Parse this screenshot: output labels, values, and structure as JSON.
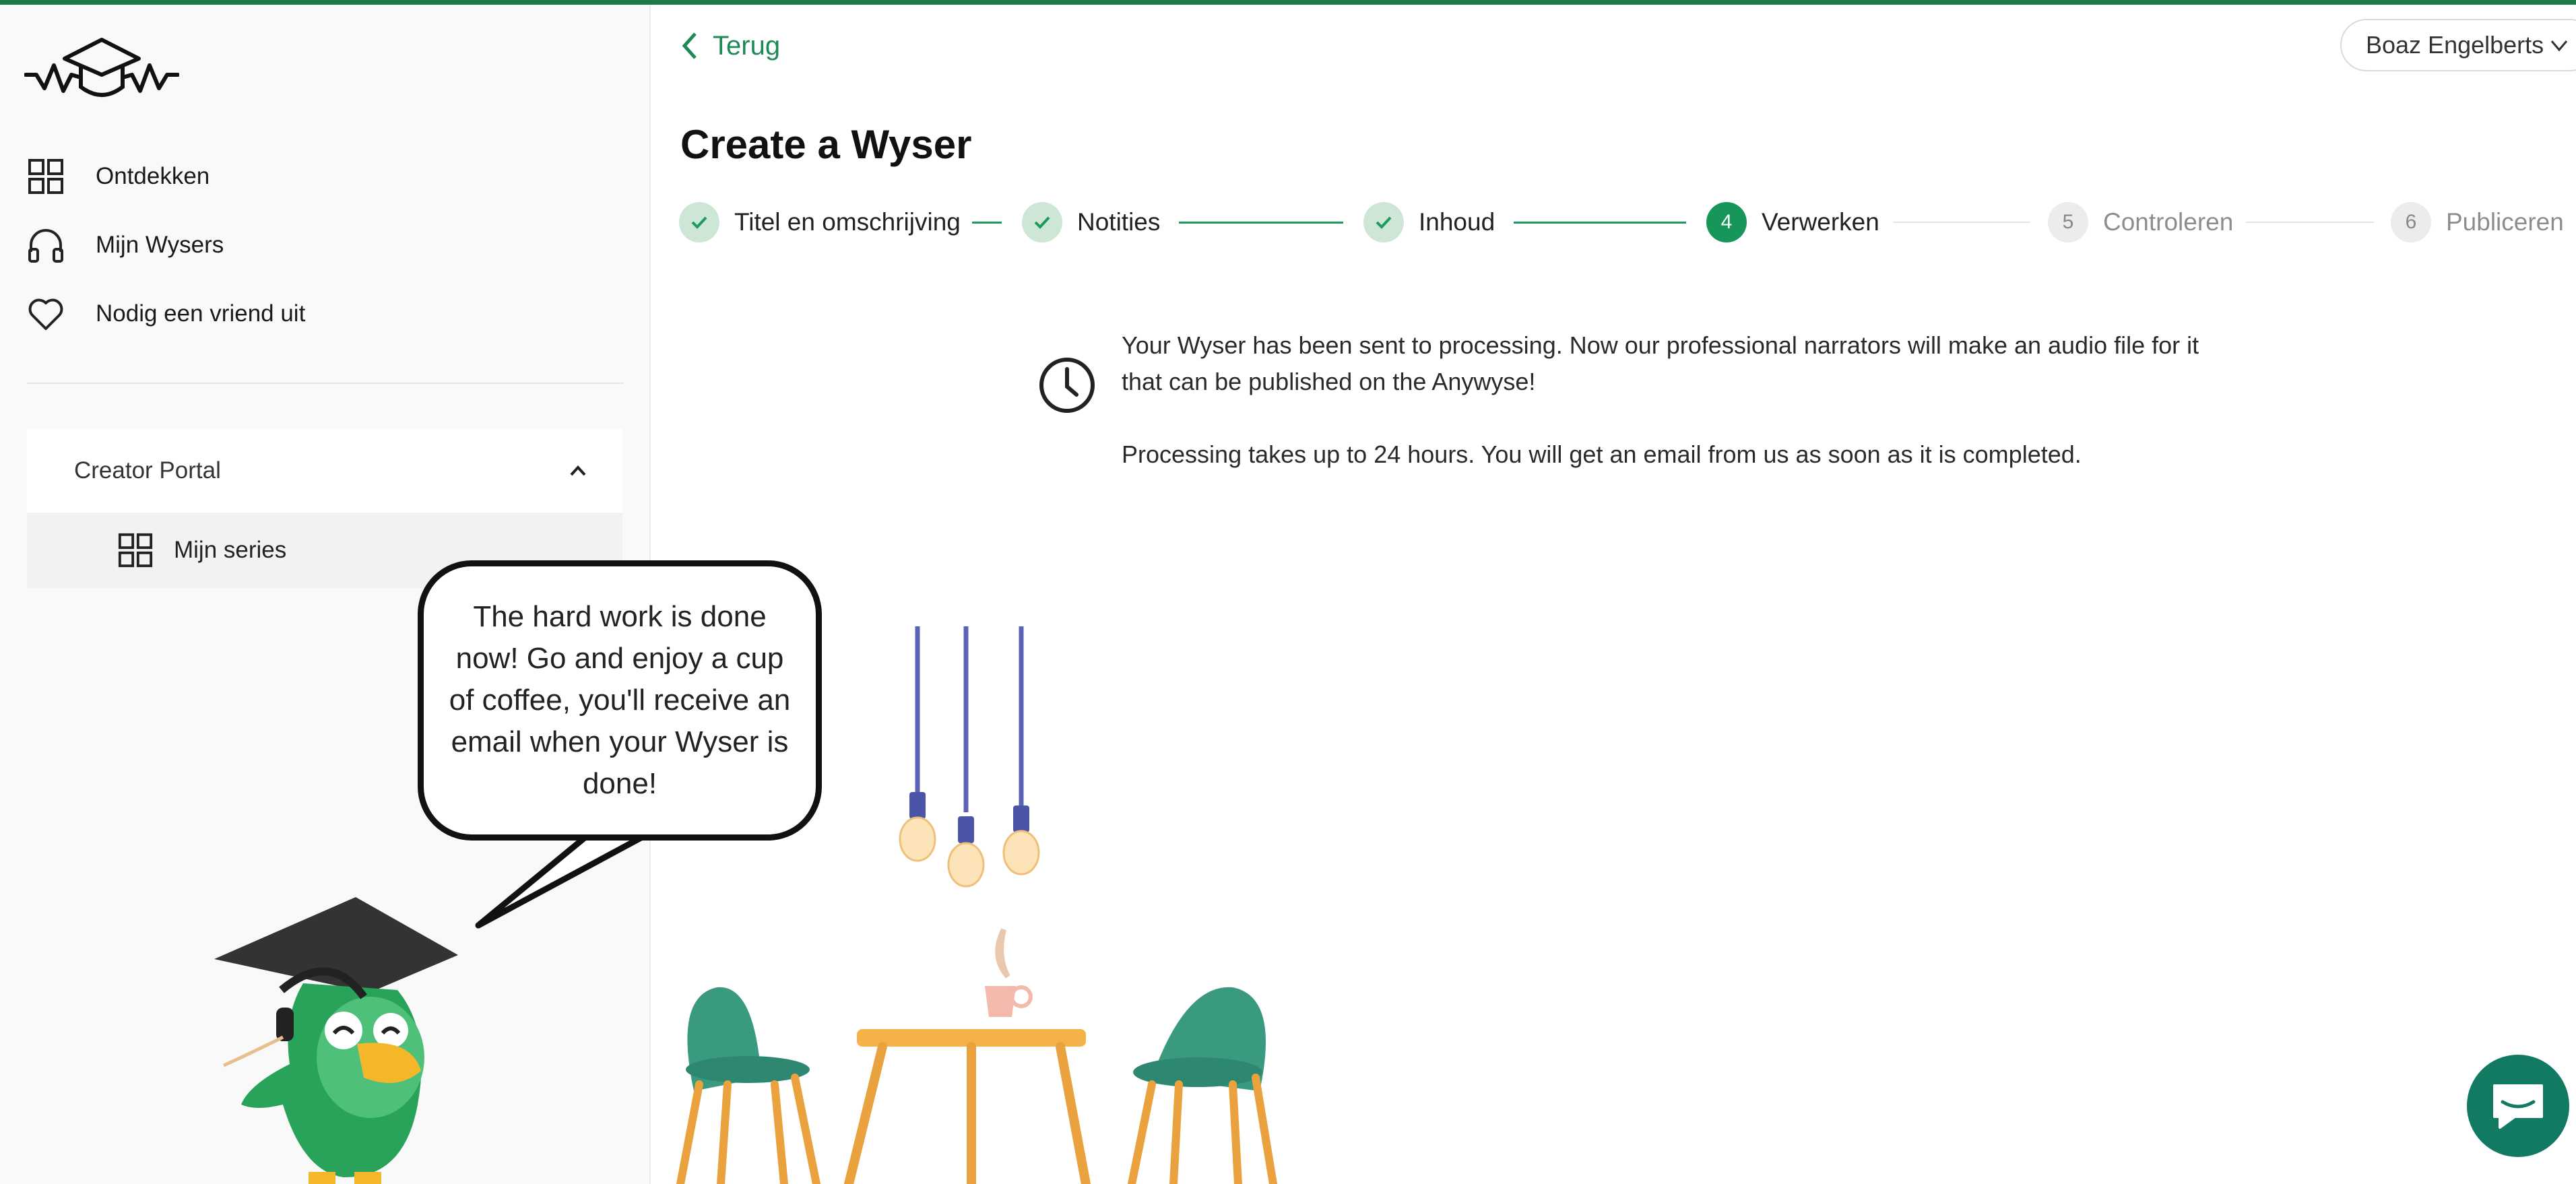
{
  "nav": {
    "items": [
      {
        "label": "Ontdekken",
        "icon": "grid-icon"
      },
      {
        "label": "Mijn Wysers",
        "icon": "headphones-icon"
      },
      {
        "label": "Nodig een vriend uit",
        "icon": "heart-icon"
      }
    ],
    "creator_portal": {
      "label": "Creator Portal",
      "expanded": true,
      "items": [
        {
          "label": "Mijn series",
          "icon": "grid-icon"
        }
      ]
    }
  },
  "bubble": {
    "text": "The hard work is done now! Go and enjoy a cup of coffee, you'll receive an email when your Wyser is done!"
  },
  "header": {
    "back_label": "Terug",
    "user_name": "Boaz Engelberts"
  },
  "page": {
    "title": "Create a Wyser"
  },
  "stepper": {
    "current_step": 4,
    "steps": [
      {
        "number": "1",
        "label": "Titel en omschrijving",
        "status": "done"
      },
      {
        "number": "2",
        "label": "Notities",
        "status": "done"
      },
      {
        "number": "3",
        "label": "Inhoud",
        "status": "done"
      },
      {
        "number": "4",
        "label": "Verwerken",
        "status": "active"
      },
      {
        "number": "5",
        "label": "Controleren",
        "status": "todo"
      },
      {
        "number": "6",
        "label": "Publiceren",
        "status": "todo"
      }
    ]
  },
  "message": {
    "line1": "Your Wyser has been sent to processing. Now our professional narrators will make an audio file for it that can be published on the Anywyse!",
    "line2": "Processing takes up to 24 hours. You will get an email from us as soon as it is completed."
  },
  "colors": {
    "accent": "#17965a",
    "top_bar": "#1e7a4a",
    "chat_button": "#127a63"
  }
}
